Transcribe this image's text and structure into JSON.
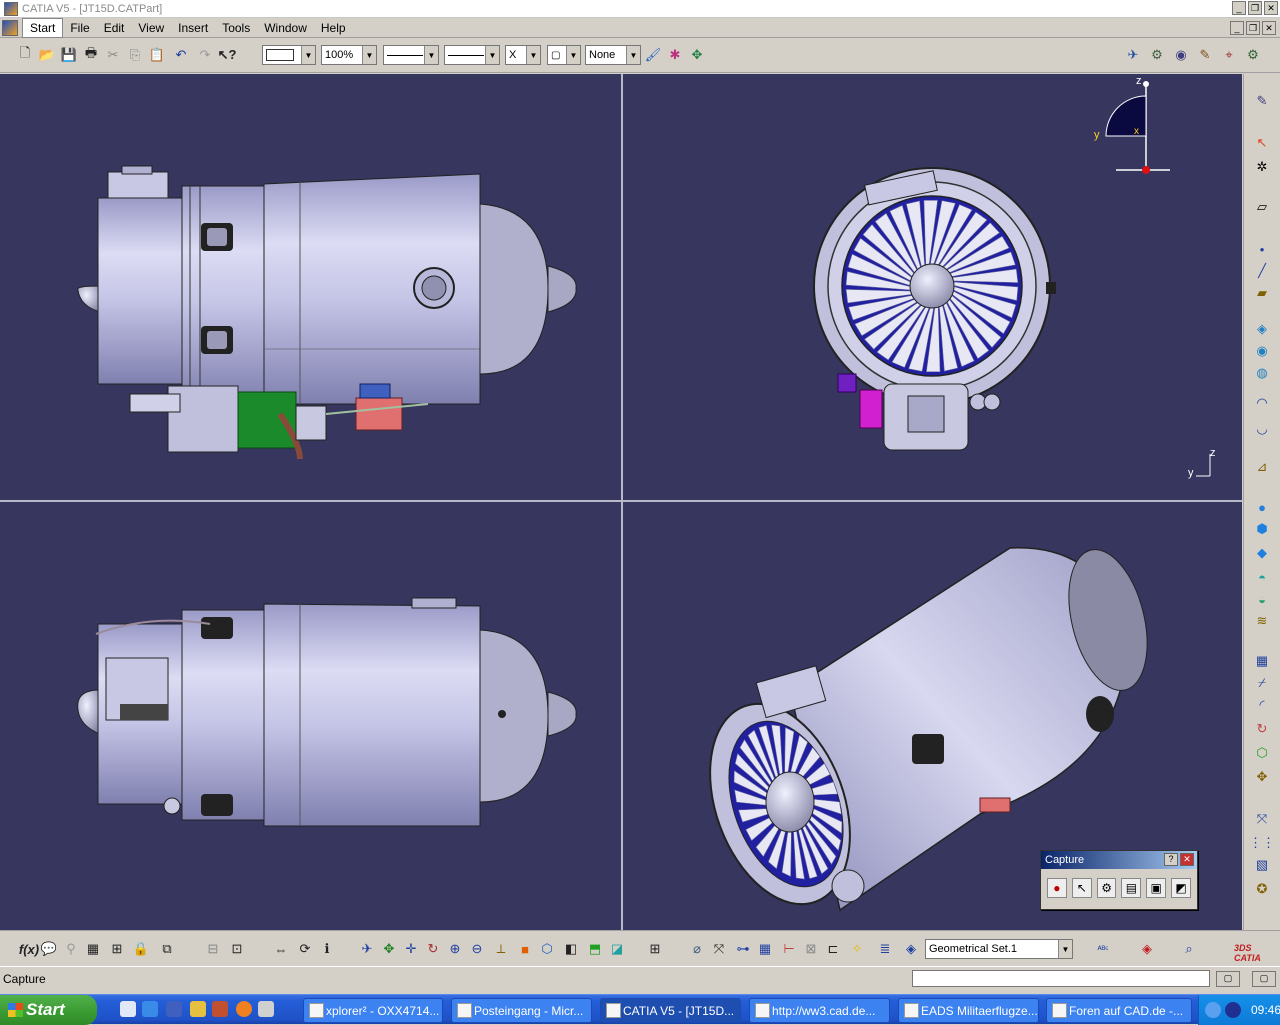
{
  "window": {
    "title": "CATIA V5 - [JT15D.CATPart]"
  },
  "menu": {
    "items": [
      "Start",
      "File",
      "Edit",
      "View",
      "Insert",
      "Tools",
      "Window",
      "Help"
    ]
  },
  "toolbar": {
    "zoom_value": "100%",
    "layer_value": "None",
    "x_value": "X"
  },
  "viewport": {
    "compass_z": "z",
    "compass_y": "y",
    "compass_x": "x",
    "axis_y": "y",
    "axis_z": "z"
  },
  "capture_panel": {
    "title": "Capture",
    "help_label": "?",
    "close_label": "✕"
  },
  "bottom_toolbar": {
    "geometrical_set": "Geometrical Set.1",
    "f_label": "f(x)"
  },
  "status": {
    "text": "Capture"
  },
  "taskbar": {
    "start_label": "Start",
    "tasks": [
      "xplorer² - OXX4714...",
      "Posteingang - Micr...",
      "CATIA V5 - [JT15D...",
      "http://ww3.cad.de...",
      "EADS Militaerflugze...",
      "Foren auf CAD.de -..."
    ],
    "clock": "09:46"
  },
  "colors": {
    "viewport_bg": "#36365e",
    "engine_body": "#c8c8e8",
    "fan_blade": "#2020a0"
  }
}
